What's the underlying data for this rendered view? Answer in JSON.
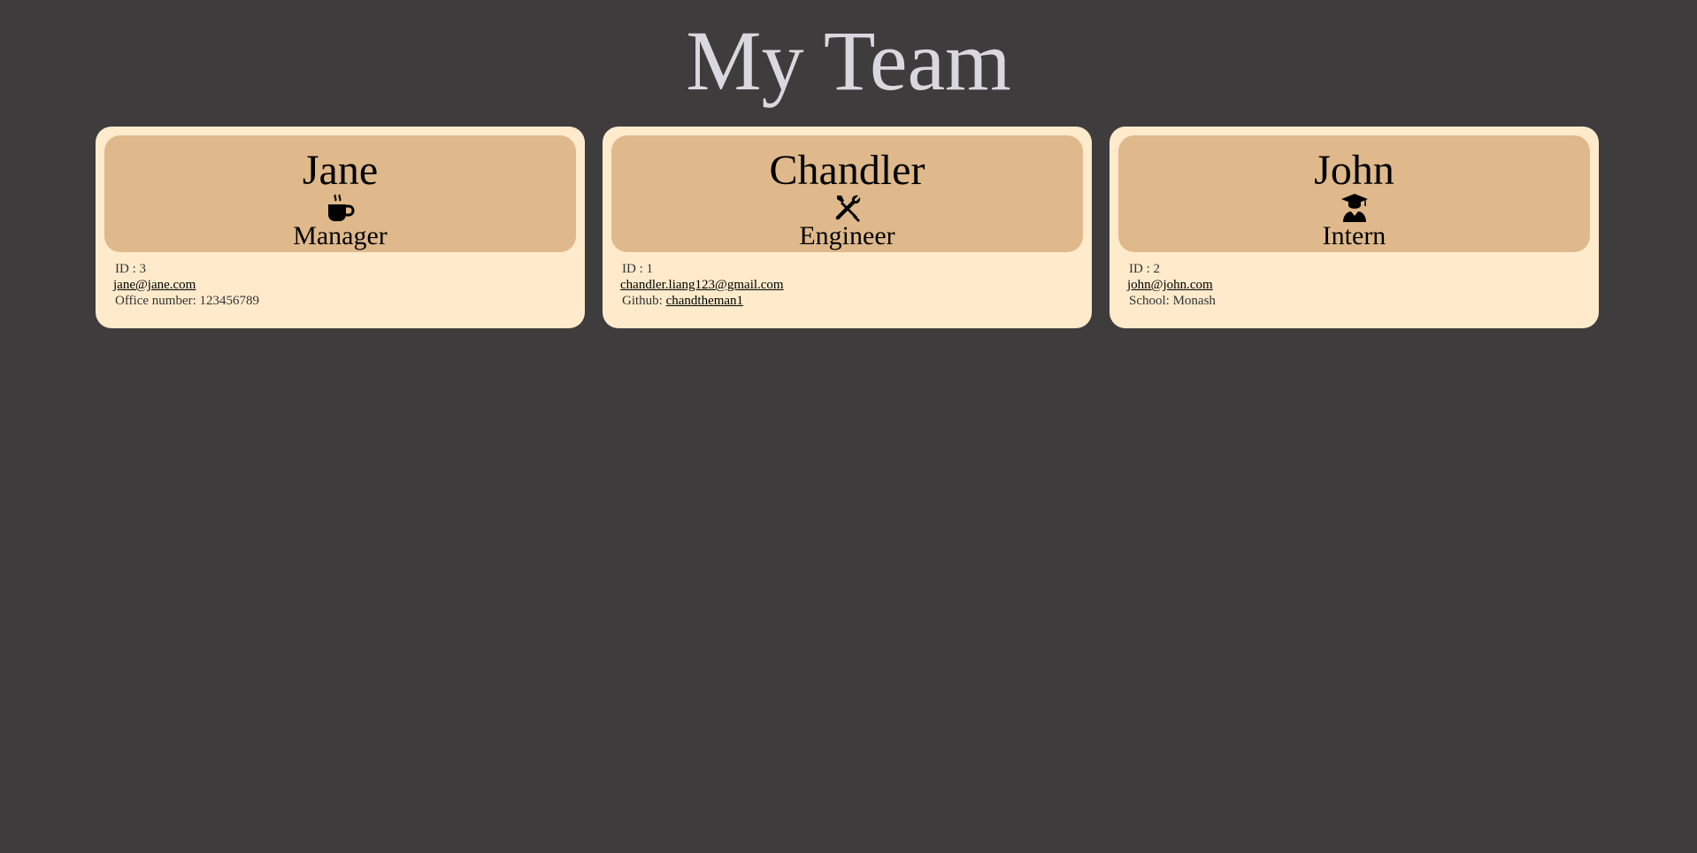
{
  "page": {
    "title": "My Team"
  },
  "cards": [
    {
      "name": "Jane",
      "role": "Manager",
      "icon": "coffee-icon",
      "id_text": "ID : 3",
      "email": "jane@jane.com",
      "extra_label": "Office number: ",
      "extra_value": "123456789"
    },
    {
      "name": "Chandler",
      "role": "Engineer",
      "icon": "tools-icon",
      "id_text": "ID : 1",
      "email": "chandler.liang123@gmail.com",
      "extra_label": "Github: ",
      "extra_value": "chandtheman1"
    },
    {
      "name": "John",
      "role": "Intern",
      "icon": "graduate-icon",
      "id_text": "ID : 2",
      "email": "john@john.com",
      "extra_label": "School: ",
      "extra_value": "Monash"
    }
  ],
  "colors": {
    "background": "#3e3c3d",
    "title": "#d9d8df",
    "card": "#ffebcc",
    "card_header": "#dfb98b"
  }
}
